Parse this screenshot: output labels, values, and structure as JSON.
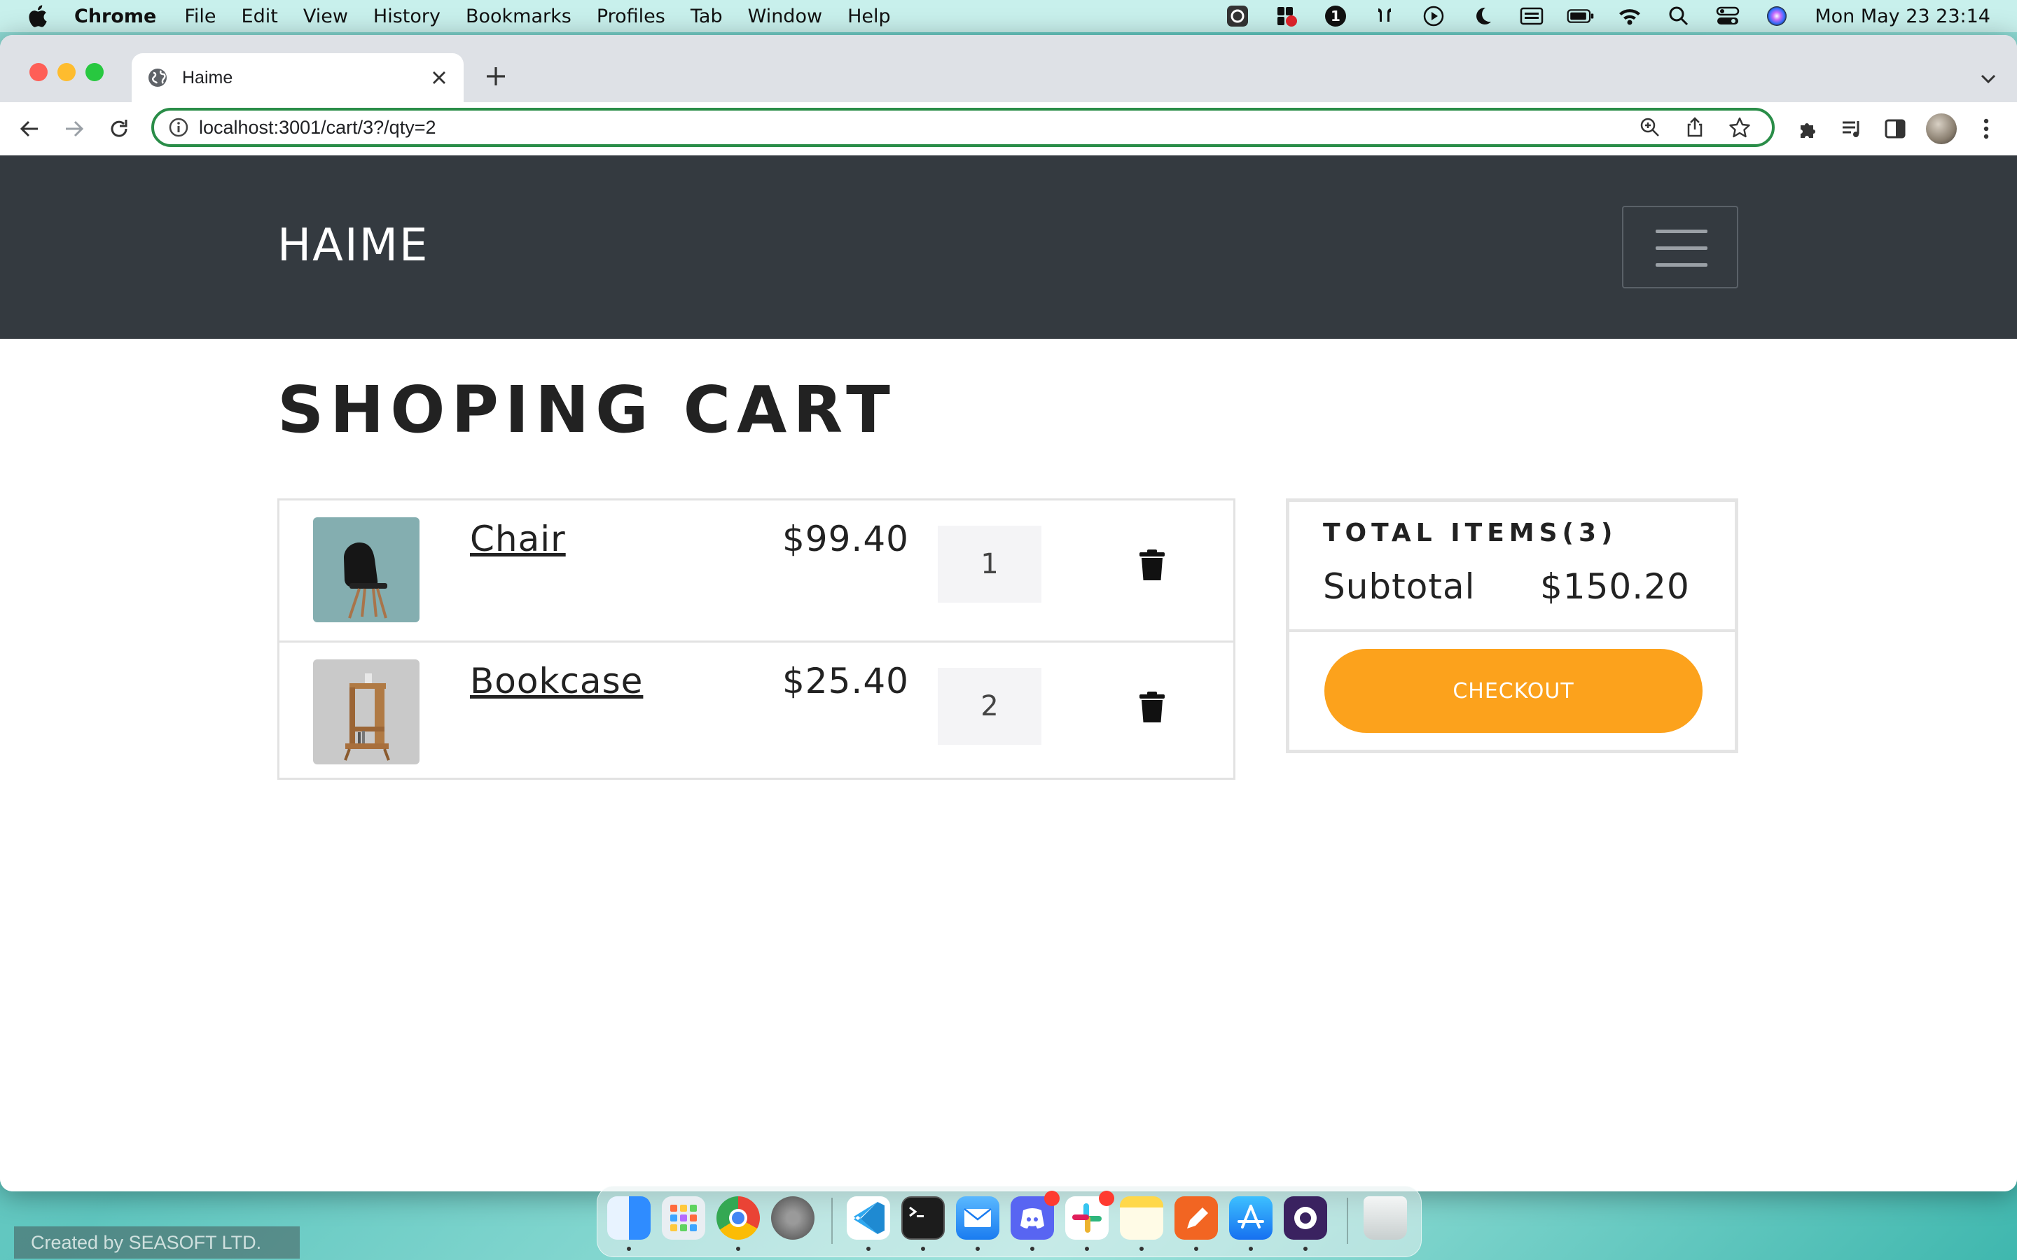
{
  "menubar": {
    "app": "Chrome",
    "items": [
      "File",
      "Edit",
      "View",
      "History",
      "Bookmarks",
      "Profiles",
      "Tab",
      "Window",
      "Help"
    ],
    "clock": "Mon May 23  23:14",
    "status_icons": [
      "screenshot-icon",
      "record-icon",
      "one-password-icon",
      "airpods-icon",
      "play-icon",
      "moon-icon",
      "keyboard-icon",
      "battery-icon",
      "wifi-icon",
      "search-icon",
      "control-center-icon",
      "siri-icon"
    ]
  },
  "browser": {
    "tab_title": "Haime",
    "url": "localhost:3001/cart/3?/qty=2",
    "accent_omnibox": "#2a8d48"
  },
  "site": {
    "brand": "HAIME",
    "navbar_color": "#343a40",
    "heading": "SHOPING CART"
  },
  "cart": {
    "items": [
      {
        "name": "Chair",
        "price": "$99.40",
        "qty": "1"
      },
      {
        "name": "Bookcase",
        "price": "$25.40",
        "qty": "2"
      }
    ]
  },
  "summary": {
    "total_items": "TOTAL ITEMS(3)",
    "subtotal_label": "Subtotal",
    "subtotal_value": "$150.20",
    "checkout_label": "CHECKOUT",
    "checkout_color": "#fca21c"
  },
  "dock": {
    "apps": [
      "finder-icon",
      "launchpad-icon",
      "chrome-icon",
      "system-preferences-icon",
      "vscode-icon",
      "terminal-icon",
      "mail-icon",
      "discord-icon",
      "slack-icon",
      "notes-icon",
      "pen-icon",
      "app-store-icon",
      "screen-recorder-icon",
      "trash-icon"
    ]
  },
  "credit": "Created by SEASOFT LTD."
}
